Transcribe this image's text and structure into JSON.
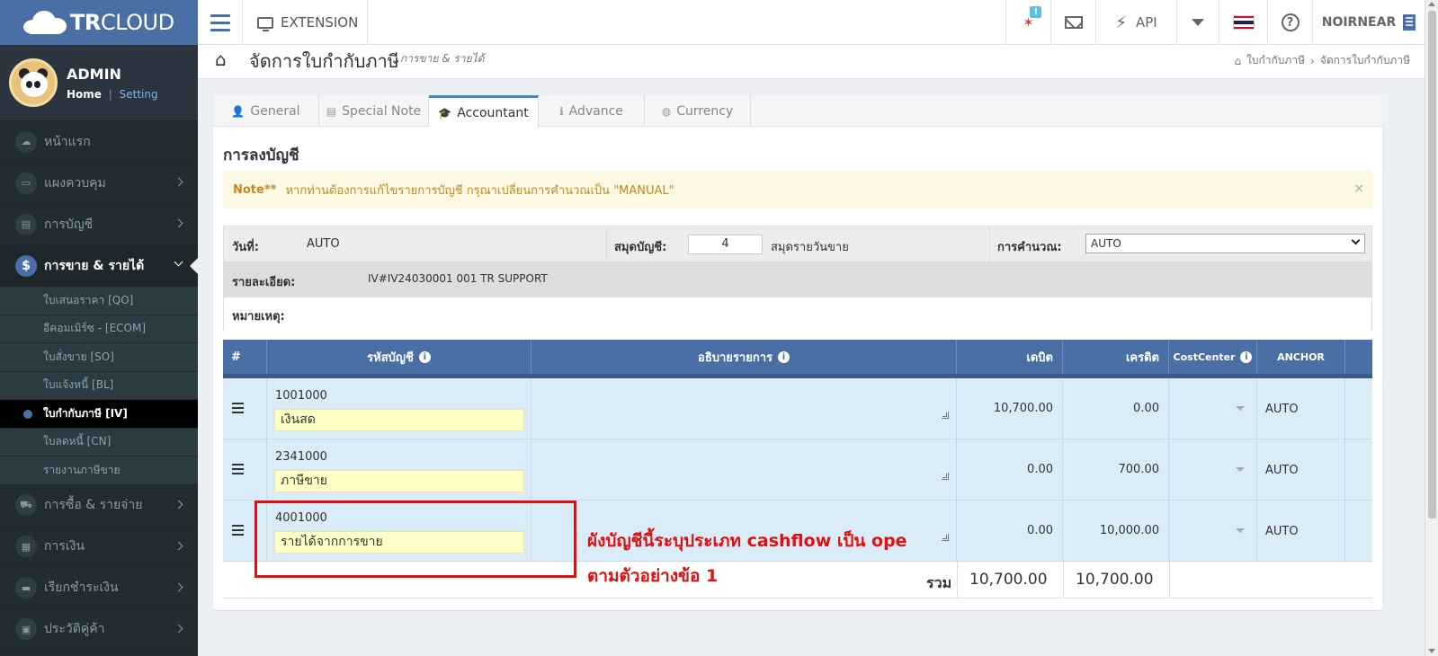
{
  "brand": {
    "bold": "TR",
    "rest": "CLOUD"
  },
  "topnav": {
    "extension_label": "EXTENSION",
    "notif_badge": "!",
    "api_label": "API",
    "user_label": "NOIRNEAR"
  },
  "user": {
    "name": "ADMIN",
    "home": "Home",
    "separator": "|",
    "setting": "Setting"
  },
  "sidebar": {
    "items_top": [
      {
        "label": "หน้าแรก",
        "icon": "cloud-icon"
      },
      {
        "label": "แผงควบคุม",
        "icon": "monitor-icon"
      },
      {
        "label": "การบัญชี",
        "icon": "book-icon"
      }
    ],
    "active": {
      "label": "การขาย & รายได้",
      "icon_glyph": "$"
    },
    "submenu": [
      {
        "label": "ใบเสนอราคา [QO]"
      },
      {
        "label": "อีคอมเมิร์ซ - [ECOM]"
      },
      {
        "label": "ใบสั่งขาย [SO]"
      },
      {
        "label": "ใบแจ้งหนี้ [BL]"
      },
      {
        "label": "ใบกำกับภาษี [IV]"
      },
      {
        "label": "ใบลดหนี้ [CN]"
      },
      {
        "label": "รายงานภาษีขาย"
      }
    ],
    "items_bottom": [
      {
        "label": "การซื้อ & รายจ่าย",
        "icon": "cart-icon"
      },
      {
        "label": "การเงิน",
        "icon": "calendar-icon"
      },
      {
        "label": "เรียกชำระเงิน",
        "icon": "card-icon"
      },
      {
        "label": "ประวัติคู่ค้า",
        "icon": "contact-icon"
      }
    ]
  },
  "page": {
    "title": "จัดการใบกำกับภาษี",
    "subtitle": "การขาย & รายได้",
    "breadcrumb": [
      "ใบกำกับภาษี",
      "จัดการใบกำกับภาษี"
    ]
  },
  "tabs": [
    {
      "label": "General",
      "glyph": "👤"
    },
    {
      "label": "Special Note",
      "glyph": "▤"
    },
    {
      "label": "Accountant",
      "glyph": "🎓"
    },
    {
      "label": "Advance",
      "glyph": "ℹ"
    },
    {
      "label": "Currency",
      "glyph": "◍"
    }
  ],
  "section_title": "การลงบัญชี",
  "alert": {
    "prefix": "Note**",
    "text": "หากท่านต้องการแก้ไขรายการบัญชี กรุณาเปลี่ยนการคำนวณเป็น \"MANUAL\"",
    "close": "×"
  },
  "journal": {
    "date_label": "วันที่:",
    "date_value": "AUTO",
    "book_label": "สมุดบัญชี:",
    "book_value": "4",
    "book_name": "สมุดรายวันขาย",
    "calc_label": "การคำนวณ:",
    "calc_value": "AUTO",
    "detail_label": "รายละเอียด:",
    "detail_value": "IV#IV24030001 001 TR SUPPORT",
    "note_label": "หมายเหตุ:"
  },
  "grid": {
    "headers": {
      "num": "#",
      "account": "รหัสบัญชี",
      "desc": "อธิบายรายการ",
      "debit": "เดบิต",
      "credit": "เครดิต",
      "costcenter": "CostCenter",
      "anchor": "ANCHOR"
    },
    "rows": [
      {
        "code": "1001000",
        "name": "เงินสด",
        "debit": "10,700.00",
        "credit": "0.00",
        "anchor": "AUTO"
      },
      {
        "code": "2341000",
        "name": "ภาษีขาย",
        "debit": "0.00",
        "credit": "700.00",
        "anchor": "AUTO"
      },
      {
        "code": "4001000",
        "name": "รายได้จากการขาย",
        "debit": "0.00",
        "credit": "10,000.00",
        "anchor": "AUTO"
      }
    ],
    "total_label": "รวม",
    "total_debit": "10,700.00",
    "total_credit": "10,700.00"
  },
  "annotation": {
    "line1": "ผังบัญชีนี้ระบุประเภท cashflow เป็น ope",
    "line2": "ตามตัวอย่างข้อ 1"
  }
}
